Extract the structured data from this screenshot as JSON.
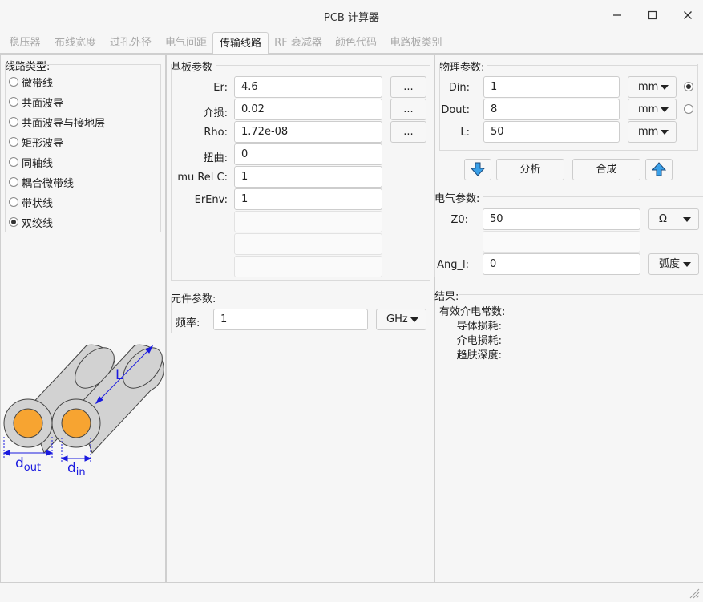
{
  "window": {
    "title": "PCB 计算器"
  },
  "tabs": [
    "稳压器",
    "布线宽度",
    "过孔外径",
    "电气间距",
    "传输线路",
    "RF 衰减器",
    "颜色代码",
    "电路板类别"
  ],
  "line_type": {
    "heading": "线路类型:",
    "options": [
      "微带线",
      "共面波导",
      "共面波导与接地层",
      "矩形波导",
      "同轴线",
      "耦合微带线",
      "带状线",
      "双绞线"
    ],
    "selected_index": 7
  },
  "substrate": {
    "heading": "基板参数",
    "fields": [
      {
        "label": "Er:",
        "value": "4.6",
        "button": "..."
      },
      {
        "label": "介损:",
        "value": "0.02",
        "button": "..."
      },
      {
        "label": "Rho:",
        "value": "1.72e-08",
        "button": "..."
      },
      {
        "label": "扭曲:",
        "value": "0"
      },
      {
        "label": "mu Rel C:",
        "value": "1"
      },
      {
        "label": "ErEnv:",
        "value": "1"
      }
    ]
  },
  "component": {
    "heading": "元件参数:",
    "freq_label": "频率:",
    "freq_value": "1",
    "freq_unit": "GHz"
  },
  "physical": {
    "heading": "物理参数:",
    "fields": [
      {
        "label": "Din:",
        "value": "1",
        "unit": "mm",
        "radio_checked": true
      },
      {
        "label": "Dout:",
        "value": "8",
        "unit": "mm",
        "radio_checked": false
      },
      {
        "label": "L:",
        "value": "50",
        "unit": "mm"
      }
    ]
  },
  "actions": {
    "analyze": "分析",
    "synthesize": "合成"
  },
  "electrical": {
    "heading": "电气参数:",
    "z0_label": "Z0:",
    "z0_value": "50",
    "z0_unit": "Ω",
    "ang_label": "Ang_l:",
    "ang_value": "0",
    "ang_unit": "弧度"
  },
  "results": {
    "heading": "结果:",
    "items": [
      "有效介电常数:",
      "导体损耗:",
      "介电损耗:",
      "趋肤深度:"
    ]
  },
  "diagram": {
    "label_l": "L",
    "label_dout": "d",
    "sub_out": "out",
    "label_din": "d",
    "sub_in": "in"
  },
  "colors": {
    "core": "#f7a431",
    "shield": "#d2d2d2",
    "dimension": "#1a1adf"
  }
}
